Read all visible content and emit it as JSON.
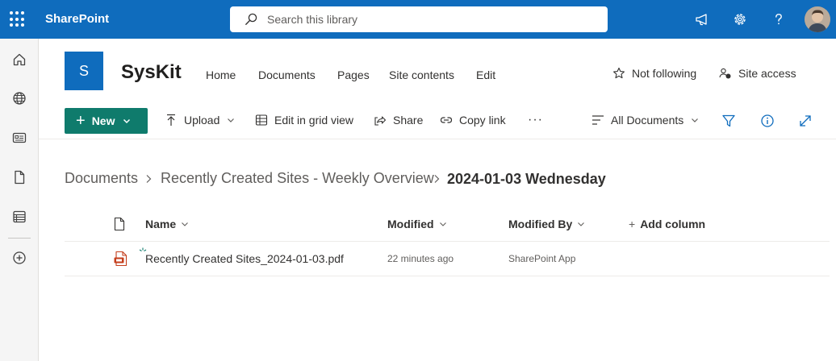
{
  "suite": {
    "app_name": "SharePoint",
    "search_placeholder": "Search this library",
    "icons": [
      "waffle-icon",
      "megaphone-icon",
      "gear-icon",
      "help-icon",
      "avatar"
    ]
  },
  "left_rail": {
    "icons": [
      "home-icon",
      "globe-icon",
      "news-icon",
      "file-icon",
      "list-icon",
      "add-icon"
    ]
  },
  "site": {
    "logo_letter": "S",
    "title": "SysKit",
    "nav": [
      "Home",
      "Documents",
      "Pages",
      "Site contents",
      "Edit"
    ],
    "follow_label": "Not following",
    "access_label": "Site access"
  },
  "command_bar": {
    "new_label": "New",
    "upload_label": "Upload",
    "grid_label": "Edit in grid view",
    "share_label": "Share",
    "copy_link_label": "Copy link",
    "more_label": "···",
    "view_label": "All Documents"
  },
  "breadcrumb": {
    "items": [
      "Documents",
      "Recently Created Sites - Weekly Overview"
    ],
    "current": "2024-01-03 Wednesday"
  },
  "list": {
    "columns": {
      "name": "Name",
      "modified": "Modified",
      "modified_by": "Modified By",
      "add_column": "Add column"
    },
    "rows": [
      {
        "name": "Recently Created Sites_2024-01-03.pdf",
        "modified": "22 minutes ago",
        "modified_by": "SharePoint App",
        "file_type": "pdf",
        "is_new": true
      }
    ]
  },
  "colors": {
    "suite_bar": "#0f6cbd",
    "new_button": "#0f7b6c",
    "pdf_icon": "#c43e1c"
  }
}
